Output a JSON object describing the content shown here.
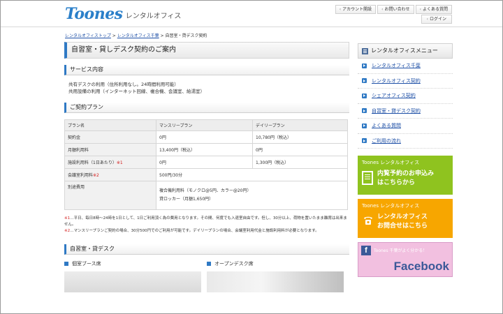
{
  "header": {
    "logo_mark": "Toones",
    "logo_sub": "レンタルオフィス",
    "nav": [
      "アカウント開設",
      "お問い合わせ",
      "よくある質問"
    ],
    "login": "ログイン"
  },
  "breadcrumb": {
    "home": "レンタルオフィストップ",
    "sep1": " > ",
    "mid": "レンタルオフィス千葉",
    "sep2": " > ",
    "current": "自習室・貸デスク契約"
  },
  "main": {
    "page_title": "自習室・貸しデスク契約のご案内",
    "service": {
      "heading": "サービス内容",
      "lines": [
        "共有デスクの利用（住所利用なし。24時間利用可能）",
        "共用設備の利用（インターネット回線、複合機、会議室、給湯室）"
      ]
    },
    "plan": {
      "heading": "ご契約プラン",
      "columns": [
        "プラン名",
        "マンスリープラン",
        "デイリープラン"
      ],
      "rows": [
        {
          "label": "契約金",
          "mark": "",
          "monthly": "0円",
          "daily": "10,780円（税込）"
        },
        {
          "label": "月額利用料",
          "mark": "",
          "monthly": "13,400円（税込）",
          "daily": "0円"
        },
        {
          "label": "施設利用料（1日あたり）",
          "mark": "※1",
          "monthly": "0円",
          "daily": "1,300円（税込）"
        },
        {
          "label": "会議室利用料",
          "mark": "※2",
          "span": "500円/30分"
        }
      ],
      "extra": {
        "label": "別途費用",
        "line1": "複合機利用料（モノクロ@5円、カラー@20円）",
        "line2": "貸ロッカー（月額1,650円）"
      },
      "notes": [
        {
          "mark": "※1",
          "text": "…平日、毎日8時〜24時を1日として、1日ご利用頂く為の費用となります。その間、何度でも入退室自由です。但し、30分以上、荷物を置いたまま離席は出来ません。"
        },
        {
          "mark": "※2",
          "text": "…マンスリープランご契約の場合、30分500円でのご利用が可能です。デイリープランの場合、会議室利用代金と施設利用料が必要となります。"
        }
      ]
    },
    "desk": {
      "heading": "自習室・貸デスク",
      "sub1": "個室ブース席",
      "sub2": "オープンデスク席"
    }
  },
  "sidebar": {
    "heading": "レンタルオフィスメニュー",
    "items": [
      "レンタルオフィス千葉",
      "レンタルオフィス契約",
      "シェアオフィス契約",
      "自習室・貸デスク契約",
      "よくある質問",
      "ご利用の流れ"
    ],
    "banner_green": {
      "small": "Toones レンタルオフィス",
      "line1": "内覧予約のお申込み",
      "line2": "はこちらから"
    },
    "banner_orange": {
      "small": "Toones レンタルオフィス",
      "line1": "レンタルオフィス",
      "line2": "お問合せはこちら"
    },
    "banner_fb": {
      "note": "Toones 千葉がよく分かる！",
      "word": "Facebook"
    }
  },
  "colors": {
    "accent": "#2f79c4",
    "green_banner": "#8fc31f",
    "orange_banner": "#f7a600",
    "facebook": "#3b5998"
  }
}
